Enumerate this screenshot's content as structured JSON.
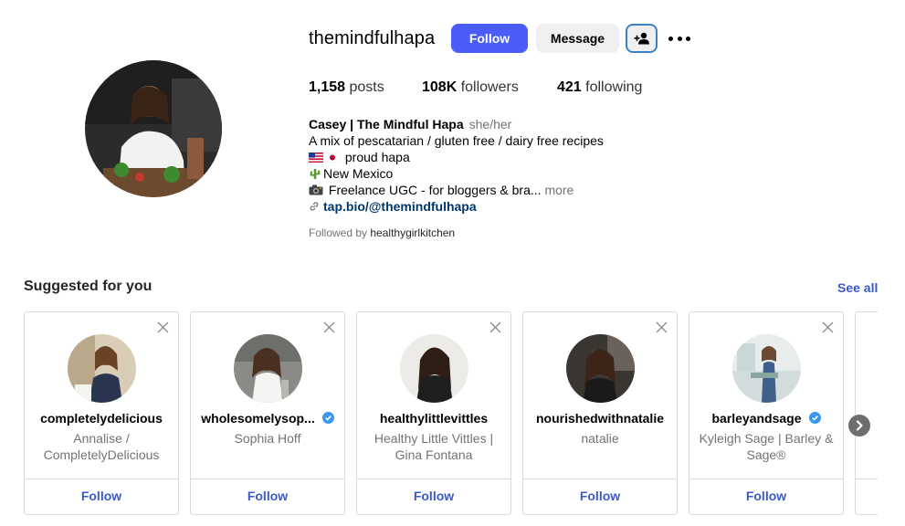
{
  "profile": {
    "username": "themindfulhapa",
    "follow_label": "Follow",
    "message_label": "Message",
    "stats": {
      "posts_count": "1,158",
      "posts_label": "posts",
      "followers_count": "108K",
      "followers_label": "followers",
      "following_count": "421",
      "following_label": "following"
    },
    "bio": {
      "display_name": "Casey | The Mindful Hapa",
      "pronouns": "she/her",
      "line1": "A mix of pescatarian / gluten free / dairy free recipes",
      "line2": "proud hapa",
      "line3": "New Mexico",
      "line4": "Freelance UGC - for bloggers & bra...",
      "more_label": "more",
      "link": "tap.bio/@themindfulhapa"
    },
    "followed_by_prefix": "Followed by",
    "followed_by_user": "healthygirlkitchen"
  },
  "suggested": {
    "title": "Suggested for you",
    "see_all": "See all",
    "cards": [
      {
        "username": "completelydelicious",
        "name": "Annalise / CompletelyDelicious",
        "follow": "Follow",
        "verified": false
      },
      {
        "username": "wholesomelysop...",
        "name": "Sophia Hoff",
        "follow": "Follow",
        "verified": true
      },
      {
        "username": "healthylittlevittles",
        "name": "Healthy Little Vittles | Gina Fontana",
        "follow": "Follow",
        "verified": false
      },
      {
        "username": "nourishedwithnatalie",
        "name": "natalie",
        "follow": "Follow",
        "verified": false
      },
      {
        "username": "barleyandsage",
        "name": "Kyleigh Sage | Barley & Sage®",
        "follow": "Follow",
        "verified": true
      }
    ]
  },
  "colors": {
    "primary_button": "#4a5df9",
    "link_blue": "#3c5ac7",
    "verified_blue": "#3897f0",
    "muted_text": "#737373"
  },
  "icons": {
    "add_user": "add-user-icon",
    "more": "more-options-icon",
    "close": "close-icon",
    "verified": "verified-badge-icon",
    "link": "link-icon",
    "next": "chevron-right-icon"
  }
}
